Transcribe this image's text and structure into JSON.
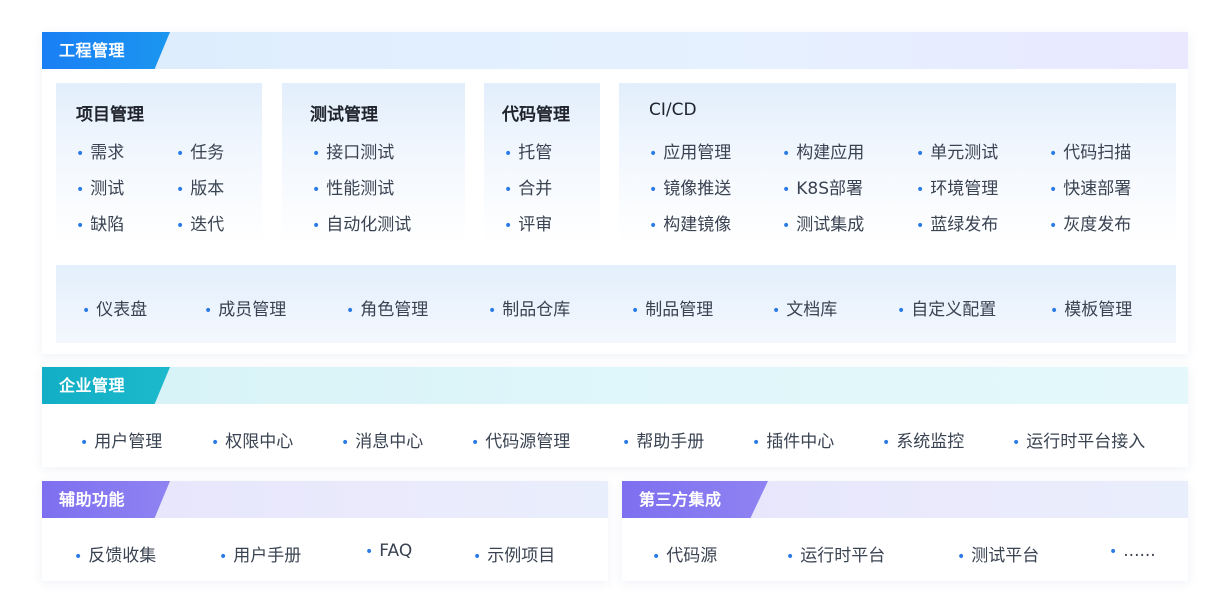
{
  "engineering": {
    "title": "工程管理",
    "cards": [
      {
        "title": "项目管理",
        "items": [
          "需求",
          "任务",
          "测试",
          "版本",
          "缺陷",
          "迭代"
        ]
      },
      {
        "title": "测试管理",
        "items": [
          "接口测试",
          "性能测试",
          "自动化测试"
        ]
      },
      {
        "title": "代码管理",
        "items": [
          "托管",
          "合并",
          "评审"
        ]
      },
      {
        "title": "CI/CD",
        "items": [
          "应用管理",
          "构建应用",
          "单元测试",
          "代码扫描",
          "镜像推送",
          "K8S部署",
          "环境管理",
          "快速部署",
          "构建镜像",
          "测试集成",
          "蓝绿发布",
          "灰度发布"
        ]
      }
    ],
    "bottom_items": [
      "仪表盘",
      "成员管理",
      "角色管理",
      "制品仓库",
      "制品管理",
      "文档库",
      "自定义配置",
      "模板管理"
    ]
  },
  "enterprise": {
    "title": "企业管理",
    "items": [
      "用户管理",
      "权限中心",
      "消息中心",
      "代码源管理",
      "帮助手册",
      "插件中心",
      "系统监控",
      "运行时平台接入"
    ]
  },
  "auxiliary": {
    "title": "辅助功能",
    "items": [
      "反馈收集",
      "用户手册",
      "FAQ",
      "示例项目"
    ]
  },
  "third_party": {
    "title": "第三方集成",
    "items": [
      "代码源",
      "运行时平台",
      "测试平台",
      "......"
    ]
  },
  "colors": {
    "engineering_tab": "#1a7ff5",
    "enterprise_tab": "#12aec5",
    "aux_tab": "#7e6ff0",
    "dot": "#2b7be5"
  }
}
